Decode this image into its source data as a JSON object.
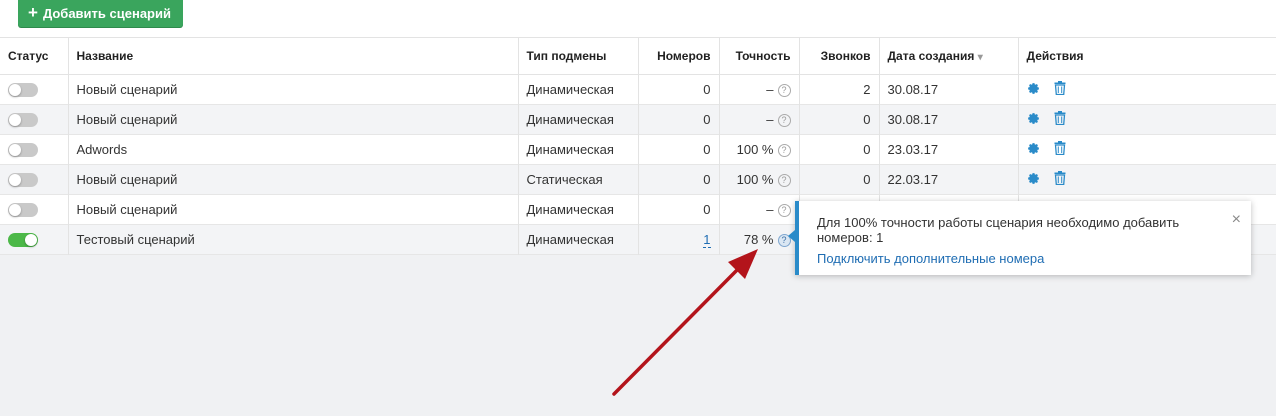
{
  "toolbar": {
    "add_label": "Добавить сценарий"
  },
  "columns": [
    "Статус",
    "Название",
    "Тип подмены",
    "Номеров",
    "Точность",
    "Звонков",
    "Дата создания",
    "Действия"
  ],
  "sort_indicator": "▾",
  "help_glyph": "?",
  "rows": [
    {
      "on": false,
      "name": "Новый сценарий",
      "type": "Динамическая",
      "numbers": "0",
      "accuracy": "–",
      "calls": "2",
      "date": "30.08.17"
    },
    {
      "on": false,
      "name": "Новый сценарий",
      "type": "Динамическая",
      "numbers": "0",
      "accuracy": "–",
      "calls": "0",
      "date": "30.08.17"
    },
    {
      "on": false,
      "name": "Adwords",
      "type": "Динамическая",
      "numbers": "0",
      "accuracy": "100 %",
      "calls": "0",
      "date": "23.03.17"
    },
    {
      "on": false,
      "name": "Новый сценарий",
      "type": "Статическая",
      "numbers": "0",
      "accuracy": "100 %",
      "calls": "0",
      "date": "22.03.17"
    },
    {
      "on": false,
      "name": "Новый сценарий",
      "type": "Динамическая",
      "numbers": "0",
      "accuracy": "–",
      "calls": "",
      "date": ""
    },
    {
      "on": true,
      "name": "Тестовый сценарий",
      "type": "Динамическая",
      "numbers": "1",
      "accuracy": "78 %",
      "calls": "",
      "date": ""
    }
  ],
  "tooltip": {
    "text": "Для 100% точности работы сценария необходимо добавить номеров: 1",
    "link": "Подключить дополнительные номера",
    "close": "×"
  },
  "colors": {
    "accent_green": "#3aa55d",
    "toggle_on": "#4cb848",
    "link_blue": "#1f6db3",
    "icon_blue": "#2a8bc9",
    "annotation_red": "#b3141b"
  }
}
